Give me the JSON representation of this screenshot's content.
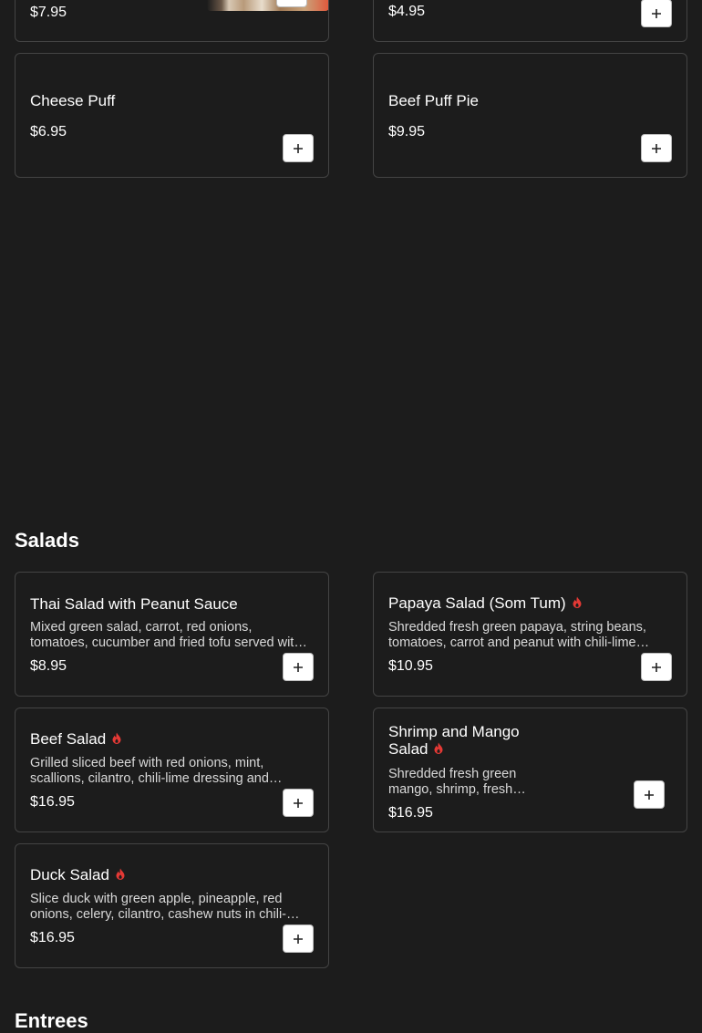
{
  "top_partial": {
    "left": {
      "price": "$7.95"
    },
    "right": {
      "price": "$4.95"
    }
  },
  "appetizers": {
    "cheese_puff": {
      "name": "Cheese Puff",
      "price": "$6.95"
    },
    "beef_puff_pie": {
      "name": "Beef Puff Pie",
      "price": "$9.95"
    }
  },
  "salads": {
    "title": "Salads",
    "items": [
      {
        "name": "Thai Salad with Peanut Sauce",
        "spicy": false,
        "desc": "Mixed green salad, carrot, red onions, tomatoes, cucumber and fried tofu served with peanut sauce.",
        "price": "$8.95"
      },
      {
        "name": "Papaya Salad (Som Tum)",
        "spicy": true,
        "desc": "Shredded fresh green papaya, string beans, tomatoes, carrot and peanut with chili-lime dressing.",
        "price": "$10.95"
      },
      {
        "name": "Beef Salad",
        "spicy": true,
        "desc": "Grilled sliced beef with red onions, mint, scallions, cilantro, chili-lime dressing and more.",
        "price": "$16.95"
      },
      {
        "name": "Shrimp and Mango Salad",
        "spicy": true,
        "desc": "Shredded fresh green mango, shrimp, fresh herbs and chili-lime dressing.",
        "price": "$16.95"
      },
      {
        "name": "Duck Salad",
        "spicy": true,
        "desc": "Slice duck with green apple, pineapple, red onions, celery, cilantro, cashew nuts in chili-lime dressing.",
        "price": "$16.95"
      }
    ]
  },
  "entrees": {
    "title": "Entrees"
  },
  "colors": {
    "background": "#1c1c1c",
    "card_border": "#444444",
    "spicy": "#e53935"
  },
  "icons": {
    "add": "plus-icon",
    "spicy": "flame-icon"
  }
}
